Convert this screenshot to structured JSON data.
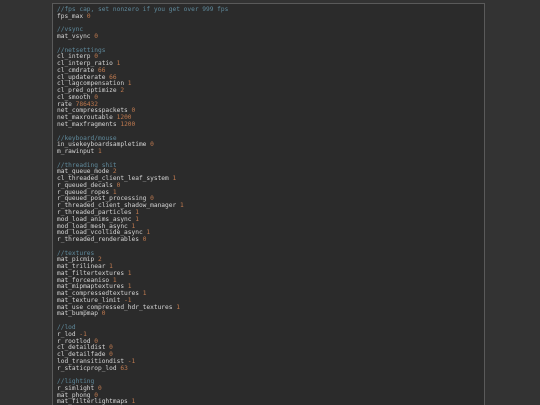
{
  "theme": {
    "background": "#333333",
    "panel_bg": "#2b2b2b",
    "text": "#d6d6d6",
    "comment": "#5f8a9c",
    "value": "#c07a4f"
  },
  "sections": [
    {
      "comment": "//fps cap, set nonzero if you get over 999 fps",
      "lines": [
        {
          "key": "fps_max",
          "value": "0"
        }
      ]
    },
    {
      "comment": "//vsync",
      "lines": [
        {
          "key": "mat_vsync",
          "value": "0"
        }
      ]
    },
    {
      "comment": "//netsettings",
      "lines": [
        {
          "key": "cl_interp",
          "value": "0"
        },
        {
          "key": "cl_interp_ratio",
          "value": "1"
        },
        {
          "key": "cl_cmdrate",
          "value": "66"
        },
        {
          "key": "cl_updaterate",
          "value": "66"
        },
        {
          "key": "cl_lagcompensation",
          "value": "1"
        },
        {
          "key": "cl_pred_optimize",
          "value": "2"
        },
        {
          "key": "cl_smooth",
          "value": "0"
        },
        {
          "key": "rate",
          "value": "786432"
        },
        {
          "key": "net_compresspackets",
          "value": "0"
        },
        {
          "key": "net_maxroutable",
          "value": "1200"
        },
        {
          "key": "net_maxfragments",
          "value": "1200"
        }
      ]
    },
    {
      "comment": "//keyboard/mouse",
      "lines": [
        {
          "key": "in_usekeyboardsampletime",
          "value": "0"
        },
        {
          "key": "m_rawinput",
          "value": "1"
        }
      ]
    },
    {
      "comment": "//threading shit",
      "lines": [
        {
          "key": "mat_queue_mode",
          "value": "2"
        },
        {
          "key": "cl_threaded_client_leaf_system",
          "value": "1"
        },
        {
          "key": "r_queued_decals",
          "value": "0"
        },
        {
          "key": "r_queued_ropes",
          "value": "1"
        },
        {
          "key": "r_queued_post_processing",
          "value": "0"
        },
        {
          "key": "r_threaded_client_shadow_manager",
          "value": "1"
        },
        {
          "key": "r_threaded_particles",
          "value": "1"
        },
        {
          "key": "mod_load_anims_async",
          "value": "1"
        },
        {
          "key": "mod_load_mesh_async",
          "value": "1"
        },
        {
          "key": "mod_load_vcollide_async",
          "value": "1"
        },
        {
          "key": "r_threaded_renderables",
          "value": "0"
        }
      ]
    },
    {
      "comment": "//textures",
      "lines": [
        {
          "key": "mat_picmip",
          "value": "2"
        },
        {
          "key": "mat_trilinear",
          "value": "1"
        },
        {
          "key": "mat_filtertextures",
          "value": "1"
        },
        {
          "key": "mat_forceaniso",
          "value": "1"
        },
        {
          "key": "mat_mipmaptextures",
          "value": "1"
        },
        {
          "key": "mat_compressedtextures",
          "value": "1"
        },
        {
          "key": "mat_texture_limit",
          "value": "-1"
        },
        {
          "key": "mat_use_compressed_hdr_textures",
          "value": "1"
        },
        {
          "key": "mat_bumpmap",
          "value": "0"
        }
      ]
    },
    {
      "comment": "//lod",
      "lines": [
        {
          "key": "r_lod",
          "value": "-1"
        },
        {
          "key": "r_rootlod",
          "value": "0"
        },
        {
          "key": "cl_detaildist",
          "value": "0"
        },
        {
          "key": "cl_detailfade",
          "value": "0"
        },
        {
          "key": "lod_transitiondist",
          "value": "-1"
        },
        {
          "key": "r_staticprop_lod",
          "value": "63"
        }
      ]
    },
    {
      "comment": "//lighting",
      "lines": [
        {
          "key": "r_simlight",
          "value": "0"
        },
        {
          "key": "mat_phong",
          "value": "0"
        },
        {
          "key": "mat_filterlightmaps",
          "value": "1"
        }
      ]
    }
  ]
}
